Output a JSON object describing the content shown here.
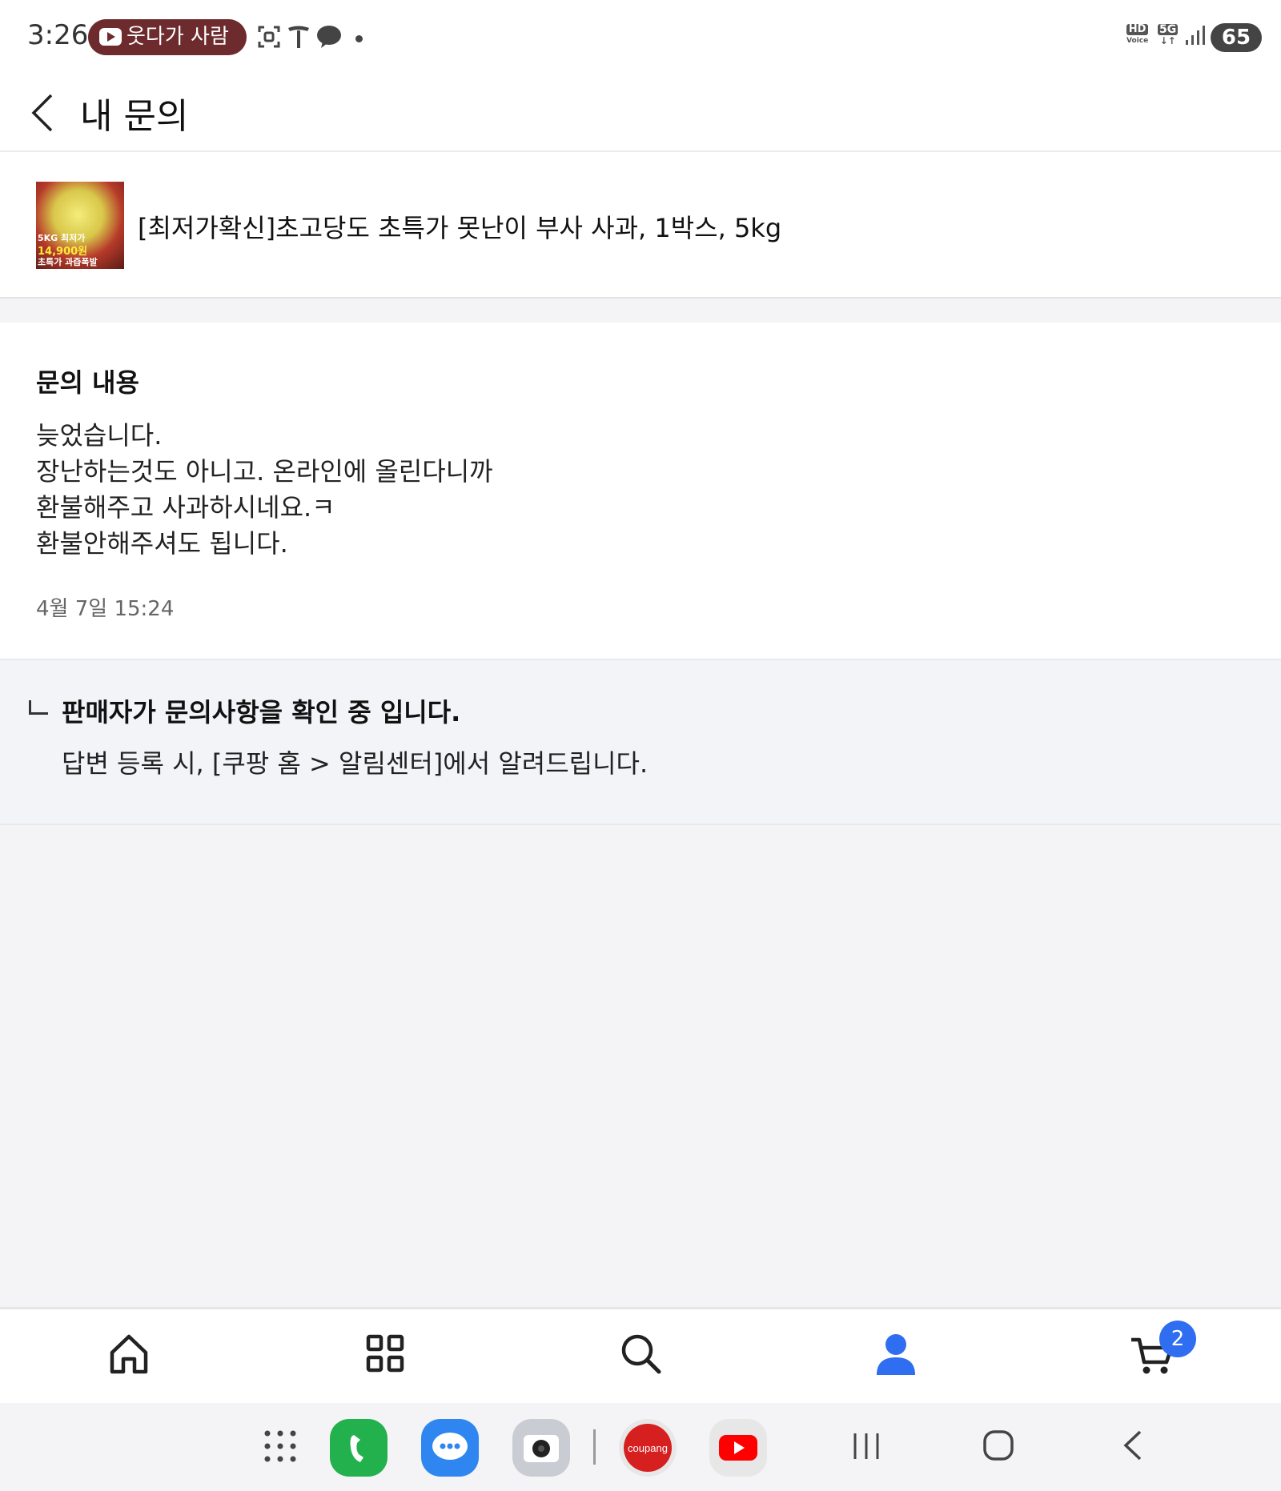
{
  "status_bar": {
    "time": "3:26",
    "media_chip": "웃다가 사람 ",
    "hd_label": "HD",
    "voice_label": "Voice",
    "network": "5G",
    "battery": "65"
  },
  "header": {
    "title": "내 문의"
  },
  "product": {
    "thumb_line1": "5KG 최저가",
    "thumb_line2": "14,900원",
    "thumb_line3": "초특가 과즙폭발",
    "name": "[최저가확신]초고당도 초특가 못난이 부사 사과, 1박스, 5kg"
  },
  "inquiry": {
    "title": "문의 내용",
    "lines": [
      "늦었습니다.",
      "장난하는것도 아니고. 온라인에 올린다니까",
      "환불해주고 사과하시네요.ㅋ",
      "환불안해주셔도 됩니다."
    ],
    "date": "4월 7일 15:24"
  },
  "reply": {
    "title": "판매자가 문의사항을 확인 중 입니다.",
    "description": "답변 등록 시, [쿠팡 홈 > 알림센터]에서 알려드립니다."
  },
  "tab_bar": {
    "cart_count": "2",
    "active_color": "#2f6ef0"
  },
  "dock": {
    "coupang_label": "coupang"
  }
}
